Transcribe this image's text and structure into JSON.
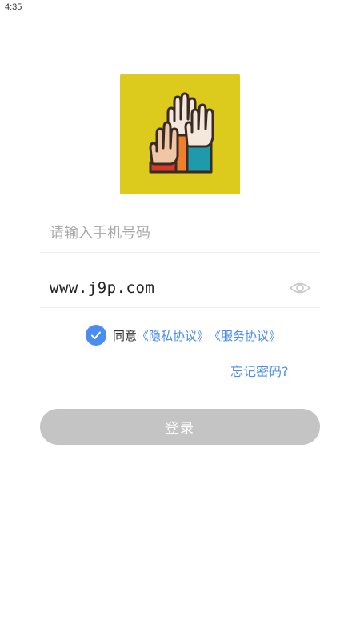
{
  "status_bar": {
    "time": "4:35"
  },
  "logo": {
    "icon": "raised-hands-logo",
    "background": "#dcca1c"
  },
  "phone": {
    "value": "",
    "placeholder": "请输入手机号码"
  },
  "password": {
    "value": "www.j9p.com",
    "toggle_icon": "eye-icon"
  },
  "agreement": {
    "checked": true,
    "prefix": "同意",
    "privacy_link": "《隐私协议》",
    "service_link": "《服务协议》"
  },
  "forgot_password": "忘记密码?",
  "login_button": "登录",
  "colors": {
    "accent": "#4a8df0",
    "button_disabled": "#c4c4c4",
    "divider": "#ededed"
  }
}
